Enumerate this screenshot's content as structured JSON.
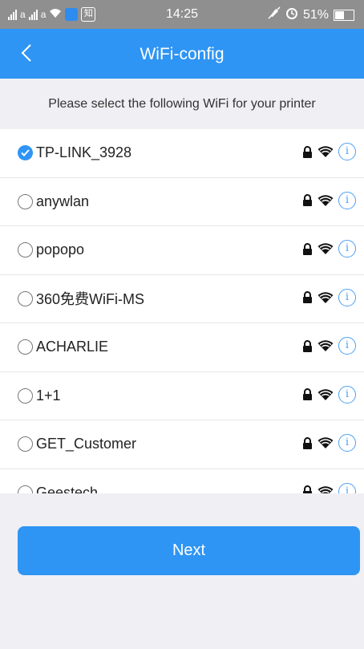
{
  "status_bar": {
    "time": "14:25",
    "battery": "51%",
    "app_badge": "知",
    "sim_labels": [
      "a",
      "a"
    ]
  },
  "navbar": {
    "title": "WiFi-config",
    "back_icon": "chevron-left-icon"
  },
  "subtitle": "Please select the following WiFi for your printer",
  "wifi_list": [
    {
      "ssid": "TP-LINK_3928",
      "selected": true
    },
    {
      "ssid": "anywlan",
      "selected": false
    },
    {
      "ssid": "popopo",
      "selected": false
    },
    {
      "ssid": "360免费WiFi-MS",
      "selected": false
    },
    {
      "ssid": "ACHARLIE",
      "selected": false
    },
    {
      "ssid": "1+1",
      "selected": false
    },
    {
      "ssid": "GET_Customer",
      "selected": false
    },
    {
      "ssid": "Geestech",
      "selected": false
    }
  ],
  "next_button": "Next",
  "colors": {
    "accent": "#2e95f4",
    "status_bar": "#8f8f8f",
    "background": "#efeff4"
  }
}
